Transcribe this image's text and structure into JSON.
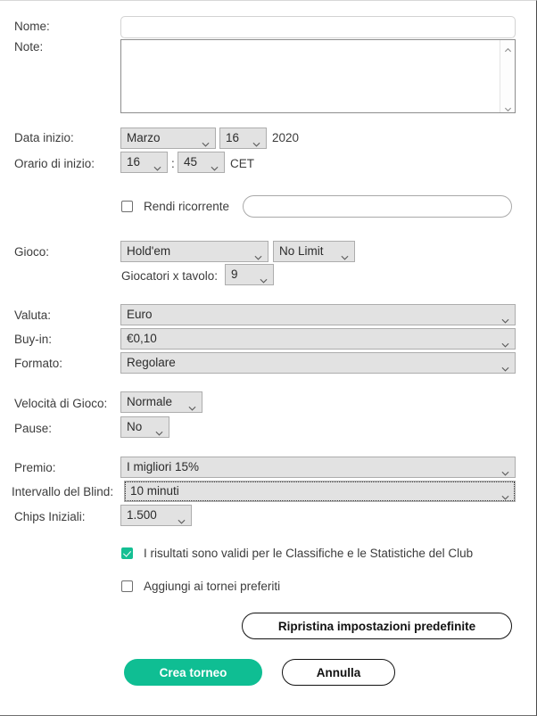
{
  "colors": {
    "accent": "#0fbe93",
    "checkbox_checked": "#14bf93",
    "select_bg": "#e2e2e2",
    "select_border": "#adadad",
    "label_text": "#3c3c3c"
  },
  "fields": {
    "nome": {
      "label": "Nome:",
      "value": "",
      "placeholder": ""
    },
    "note": {
      "label": "Note:",
      "value": "",
      "placeholder": ""
    },
    "data_inizio": {
      "label": "Data inizio:",
      "month": "Marzo",
      "day": "16",
      "year": "2020"
    },
    "orario_inizio": {
      "label": "Orario di inizio:",
      "hour": "16",
      "separator": ":",
      "minute": "45",
      "timezone": "CET"
    },
    "rendi_ricorrente": {
      "label": "Rendi ricorrente",
      "checked": false,
      "value": "",
      "placeholder": ""
    },
    "gioco": {
      "label": "Gioco:",
      "variant": "Hold'em",
      "limit": "No Limit"
    },
    "giocatori_x_tavolo": {
      "label": "Giocatori x tavolo:",
      "value": "9"
    },
    "valuta": {
      "label": "Valuta:",
      "value": "Euro"
    },
    "buy_in": {
      "label": "Buy-in:",
      "value": "€0,10"
    },
    "formato": {
      "label": "Formato:",
      "value": "Regolare"
    },
    "velocita_di_gioco": {
      "label": "Velocità di Gioco:",
      "value": "Normale"
    },
    "pause": {
      "label": "Pause:",
      "value": "No"
    },
    "premio": {
      "label": "Premio:",
      "value": "I migliori 15%"
    },
    "intervallo_del_blind": {
      "label": "Intervallo del Blind:",
      "value": "10 minuti",
      "focused": true
    },
    "chips_iniziali": {
      "label": "Chips Iniziali:",
      "value": "1.500"
    }
  },
  "checkboxes": {
    "risultati_validi": {
      "label": "I risultati sono validi per le Classifiche e le Statistiche del Club",
      "checked": true
    },
    "aggiungi_preferiti": {
      "label": "Aggiungi ai tornei preferiti",
      "checked": false
    }
  },
  "buttons": {
    "ripristina": "Ripristina impostazioni predefinite",
    "crea_torneo": "Crea torneo",
    "annulla": "Annulla"
  },
  "icons": {
    "chevron_down": "chevron-down-icon",
    "scroll_up": "scroll-up-icon",
    "scroll_down": "scroll-down-icon"
  }
}
